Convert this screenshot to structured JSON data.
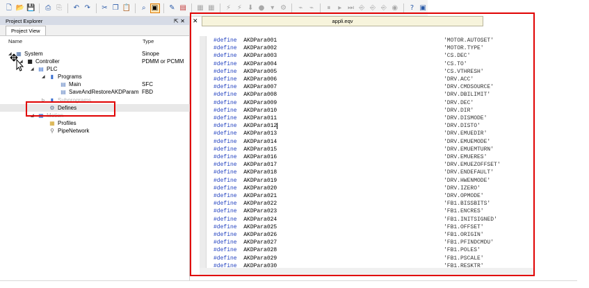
{
  "toolbar": {
    "buttons": [
      {
        "name": "new-icon",
        "glyph": "🗋",
        "style": ""
      },
      {
        "name": "open-folder-icon",
        "glyph": "📂",
        "style": ""
      },
      {
        "name": "save-icon",
        "glyph": "💾",
        "style": ""
      },
      {
        "name": "sep",
        "glyph": "",
        "style": "sep"
      },
      {
        "name": "print-icon",
        "glyph": "⎙",
        "style": ""
      },
      {
        "name": "print-preview-icon",
        "glyph": "⎘",
        "style": "dim"
      },
      {
        "name": "sep",
        "glyph": "",
        "style": "sep"
      },
      {
        "name": "undo-icon",
        "glyph": "↶",
        "style": ""
      },
      {
        "name": "redo-icon",
        "glyph": "↷",
        "style": ""
      },
      {
        "name": "sep",
        "glyph": "",
        "style": "sep"
      },
      {
        "name": "cut-icon",
        "glyph": "✂",
        "style": ""
      },
      {
        "name": "copy-icon",
        "glyph": "❐",
        "style": ""
      },
      {
        "name": "paste-icon",
        "glyph": "📋",
        "style": ""
      },
      {
        "name": "sep",
        "glyph": "",
        "style": "sep"
      },
      {
        "name": "find-icon",
        "glyph": "⌕",
        "style": ""
      },
      {
        "name": "toggle-view-icon",
        "glyph": "▣",
        "style": "active"
      },
      {
        "name": "sep",
        "glyph": "",
        "style": "sep"
      },
      {
        "name": "tools-icon",
        "glyph": "✎",
        "style": ""
      },
      {
        "name": "device-icon",
        "glyph": "▤",
        "style": "red"
      },
      {
        "name": "sep",
        "glyph": "",
        "style": "sep"
      },
      {
        "name": "compile-icon",
        "glyph": "▦",
        "style": "dim"
      },
      {
        "name": "build-icon",
        "glyph": "▦",
        "style": "dim"
      },
      {
        "name": "sep",
        "glyph": "",
        "style": "sep"
      },
      {
        "name": "connect-icon",
        "glyph": "⚡",
        "style": "dim"
      },
      {
        "name": "disconnect-icon",
        "glyph": "⚡",
        "style": "dim"
      },
      {
        "name": "download-icon",
        "glyph": "⬇",
        "style": "dim"
      },
      {
        "name": "stop-icon",
        "glyph": "●",
        "style": "dim"
      },
      {
        "name": "stop-dropdown-icon",
        "glyph": "▾",
        "style": "dim"
      },
      {
        "name": "settings-icon",
        "glyph": "⚙",
        "style": "dim"
      },
      {
        "name": "sep",
        "glyph": "",
        "style": "sep"
      },
      {
        "name": "scope-icon",
        "glyph": "⌁",
        "style": "dim"
      },
      {
        "name": "watch-icon",
        "glyph": "⌁",
        "style": "dim"
      },
      {
        "name": "sep",
        "glyph": "",
        "style": "sep"
      },
      {
        "name": "pause-icon",
        "glyph": "⏸",
        "style": "dim"
      },
      {
        "name": "step-icon",
        "glyph": "▸",
        "style": "dim"
      },
      {
        "name": "fast-forward-icon",
        "glyph": "⏭",
        "style": "dim"
      },
      {
        "name": "step-into-icon",
        "glyph": "⎆",
        "style": "dim"
      },
      {
        "name": "step-over-icon",
        "glyph": "⎆",
        "style": "dim"
      },
      {
        "name": "step-out-icon",
        "glyph": "⎆",
        "style": "dim"
      },
      {
        "name": "breakpoint-icon",
        "glyph": "◉",
        "style": "dim"
      },
      {
        "name": "sep",
        "glyph": "",
        "style": "sep"
      },
      {
        "name": "help-icon",
        "glyph": "?",
        "style": ""
      },
      {
        "name": "about-icon",
        "glyph": "▣",
        "style": ""
      }
    ]
  },
  "explorer": {
    "title": "Project Explorer",
    "pin_glyph": "⇱ ✕",
    "tab_label": "Project View",
    "col_name": "Name",
    "col_type": "Type",
    "rows": [
      {
        "label": "System",
        "type": "Sinope",
        "indent": 0,
        "expander": "◢",
        "icon": "▦",
        "icon_color": "#4a6fa8",
        "name": "tree-item-system"
      },
      {
        "label": "Controller",
        "type": "PDMM or PCMM",
        "indent": 1,
        "expander": "◢",
        "icon": "■",
        "icon_color": "#222222",
        "name": "tree-item-controller"
      },
      {
        "label": "PLC",
        "type": "",
        "indent": 2,
        "expander": "◢",
        "icon": "▤",
        "icon_color": "#3a6fd0",
        "name": "tree-item-plc"
      },
      {
        "label": "Programs",
        "type": "",
        "indent": 3,
        "expander": "◢",
        "icon": "▮",
        "icon_color": "#3a6fd0",
        "name": "tree-item-programs"
      },
      {
        "label": "Main",
        "type": "SFC",
        "indent": 4,
        "expander": "",
        "icon": "▤",
        "icon_color": "#5a7fc0",
        "name": "tree-item-main"
      },
      {
        "label": "SaveAndRestoreAKDParam",
        "type": "FBD",
        "indent": 4,
        "expander": "",
        "icon": "▤",
        "icon_color": "#5a7fc0",
        "name": "tree-item-save-restore"
      },
      {
        "label": "Subprograms",
        "type": "",
        "indent": 3,
        "expander": "▷",
        "icon": "▮",
        "icon_color": "#3a6fd0",
        "name": "tree-item-subprograms"
      },
      {
        "label": "Defines",
        "type": "",
        "indent": 3,
        "expander": "",
        "icon": "⚙",
        "icon_color": "#5a7090",
        "name": "tree-item-defines"
      },
      {
        "label": "Motion",
        "type": "",
        "indent": 2,
        "expander": "◢",
        "icon": "▦",
        "icon_color": "#3a6fd0",
        "name": "tree-item-motion"
      },
      {
        "label": "Profiles",
        "type": "",
        "indent": 3,
        "expander": "",
        "icon": "▦",
        "icon_color": "#d0a020",
        "name": "tree-item-profiles"
      },
      {
        "label": "PipeNetwork",
        "type": "",
        "indent": 3,
        "expander": "",
        "icon": "⚲",
        "icon_color": "#6a6a6a",
        "name": "tree-item-pipenetwork"
      }
    ]
  },
  "editor": {
    "tab_title": "appli.eqv",
    "close_glyph": "✕",
    "keyword": "#define",
    "lines": [
      {
        "name": "AKDPara001",
        "value": "'MOTOR.AUTOSET'"
      },
      {
        "name": "AKDPara002",
        "value": "'MOTOR.TYPE'"
      },
      {
        "name": "AKDPara003",
        "value": "'CS.DEC'"
      },
      {
        "name": "AKDPara004",
        "value": "'CS.TO'"
      },
      {
        "name": "AKDPara005",
        "value": "'CS.VTHRESH'"
      },
      {
        "name": "AKDPara006",
        "value": "'DRV.ACC'"
      },
      {
        "name": "AKDPara007",
        "value": "'DRV.CMDSOURCE'"
      },
      {
        "name": "AKDPara008",
        "value": "'DRV.DBILIMIT'"
      },
      {
        "name": "AKDPara009",
        "value": "'DRV.DEC'"
      },
      {
        "name": "AKDPara010",
        "value": "'DRV.DIR'"
      },
      {
        "name": "AKDPara011",
        "value": "'DRV.DISMODE'"
      },
      {
        "name": "AKDPara012",
        "value": "'DRV.DISTO'"
      },
      {
        "name": "AKDPara013",
        "value": "'DRV.EMUEDIR'"
      },
      {
        "name": "AKDPara014",
        "value": "'DRV.EMUEMODE'"
      },
      {
        "name": "AKDPara015",
        "value": "'DRV.EMUEMTURN'"
      },
      {
        "name": "AKDPara016",
        "value": "'DRV.EMUERES'"
      },
      {
        "name": "AKDPara017",
        "value": "'DRV.EMUEZOFFSET'"
      },
      {
        "name": "AKDPara018",
        "value": "'DRV.ENDEFAULT'"
      },
      {
        "name": "AKDPara019",
        "value": "'DRV.HWENMODE'"
      },
      {
        "name": "AKDPara020",
        "value": "'DRV.IZERO'"
      },
      {
        "name": "AKDPara021",
        "value": "'DRV.OPMODE'"
      },
      {
        "name": "AKDPara022",
        "value": "'FB1.BISSBITS'"
      },
      {
        "name": "AKDPara023",
        "value": "'FB1.ENCRES'"
      },
      {
        "name": "AKDPara024",
        "value": "'FB1.INITSIGNED'"
      },
      {
        "name": "AKDPara025",
        "value": "'FB1.OFFSET'"
      },
      {
        "name": "AKDPara026",
        "value": "'FB1.ORIGIN'"
      },
      {
        "name": "AKDPara027",
        "value": "'FB1.PFINDCMDU'"
      },
      {
        "name": "AKDPara028",
        "value": "'FB1.POLES'"
      },
      {
        "name": "AKDPara029",
        "value": "'FB1.PSCALE'"
      },
      {
        "name": "AKDPara030",
        "value": "'FB1.RESKTR'"
      }
    ]
  }
}
